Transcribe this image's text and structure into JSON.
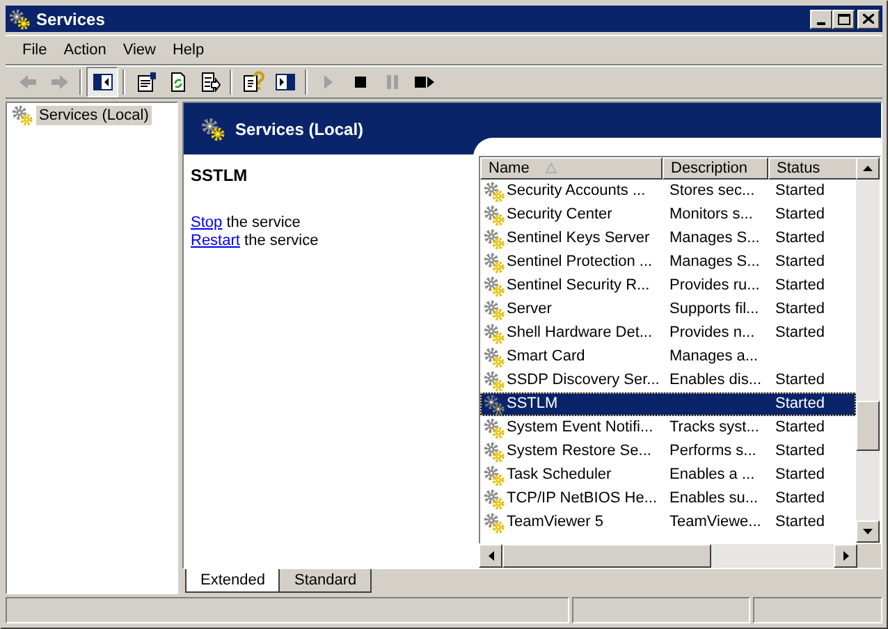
{
  "window": {
    "title": "Services"
  },
  "menu": [
    "File",
    "Action",
    "View",
    "Help"
  ],
  "toolbar": [
    {
      "disabled": true,
      "pressed": false
    },
    {
      "disabled": true,
      "pressed": false
    },
    {
      "disabled": false,
      "pressed": true
    },
    {
      "disabled": false,
      "pressed": false
    },
    {
      "disabled": false,
      "pressed": false
    },
    {
      "disabled": false,
      "pressed": false
    },
    {
      "disabled": false,
      "pressed": false
    },
    {
      "disabled": false,
      "pressed": false
    },
    {
      "disabled": true,
      "pressed": false
    },
    {
      "disabled": false,
      "pressed": false
    },
    {
      "disabled": true,
      "pressed": false
    },
    {
      "disabled": false,
      "pressed": false
    }
  ],
  "tree": [
    {
      "label": "Services (Local)",
      "selected": true
    }
  ],
  "header": {
    "title": "Services (Local)"
  },
  "details": {
    "service_name": "SSTLM",
    "actions": [
      {
        "link": "Stop",
        "text": "the service"
      },
      {
        "link": "Restart",
        "text": "the service"
      }
    ]
  },
  "table": {
    "columns": [
      {
        "label": "Name",
        "sorted": true
      },
      {
        "label": "Description",
        "sorted": false
      },
      {
        "label": "Status",
        "sorted": false
      }
    ],
    "rows": [
      {
        "name": "Security Accounts ...",
        "description": "Stores sec...",
        "status": "Started",
        "selected": false
      },
      {
        "name": "Security Center",
        "description": "Monitors s...",
        "status": "Started",
        "selected": false
      },
      {
        "name": "Sentinel Keys Server",
        "description": "Manages S...",
        "status": "Started",
        "selected": false
      },
      {
        "name": "Sentinel Protection ...",
        "description": "Manages S...",
        "status": "Started",
        "selected": false
      },
      {
        "name": "Sentinel Security R...",
        "description": "Provides ru...",
        "status": "Started",
        "selected": false
      },
      {
        "name": "Server",
        "description": "Supports fil...",
        "status": "Started",
        "selected": false
      },
      {
        "name": "Shell Hardware Det...",
        "description": "Provides n...",
        "status": "Started",
        "selected": false
      },
      {
        "name": "Smart Card",
        "description": "Manages a...",
        "selected": false
      },
      {
        "name": "SSDP Discovery Ser...",
        "description": "Enables dis...",
        "status": "Started",
        "selected": false
      },
      {
        "name": "SSTLM",
        "status": "Started",
        "selected": true
      },
      {
        "name": "System Event Notifi...",
        "description": "Tracks syst...",
        "status": "Started",
        "selected": false
      },
      {
        "name": "System Restore Se...",
        "description": "Performs s...",
        "status": "Started",
        "selected": false
      },
      {
        "name": "Task Scheduler",
        "description": "Enables a ...",
        "status": "Started",
        "selected": false
      },
      {
        "name": "TCP/IP NetBIOS He...",
        "description": "Enables su...",
        "status": "Started",
        "selected": false
      },
      {
        "name": "TeamViewer 5",
        "description": "TeamViewe...",
        "status": "Started",
        "selected": false
      }
    ]
  },
  "tabs": [
    {
      "label": "Extended",
      "selected": true
    },
    {
      "label": "Standard",
      "selected": false
    }
  ]
}
